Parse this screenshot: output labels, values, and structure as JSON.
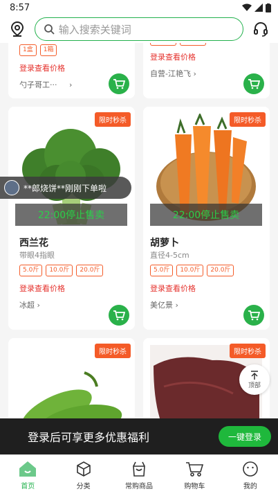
{
  "status": {
    "time": "8:57"
  },
  "search": {
    "placeholder": "输入搜索关键词"
  },
  "feed": {
    "top_left": {
      "tags": [
        "1盒",
        "1箱"
      ],
      "price_login": "登录查看价格",
      "seller": "勺子哥工···"
    },
    "top_right": {
      "price_login": "登录查看价格",
      "seller": "自营-江艳飞"
    },
    "products": [
      {
        "badge": "限时秒杀",
        "overlay": "22:00停止售卖",
        "name": "西兰花",
        "spec": "带眼4指眼",
        "tags": [
          "5.0斤",
          "10.0斤",
          "20.0斤"
        ],
        "price_login": "登录查看价格",
        "seller": "冰超"
      },
      {
        "badge": "限时秒杀",
        "overlay": "22:00停止售卖",
        "name": "胡萝卜",
        "spec": "直径4-5cm",
        "tags": [
          "5.0斤",
          "10.0斤",
          "20.0斤"
        ],
        "price_login": "登录查看价格",
        "seller": "美亿景"
      },
      {
        "badge": "限时秒杀"
      },
      {
        "badge": "限时秒杀"
      }
    ]
  },
  "toast": {
    "text": "**郎烧饼**刚刚下单啦"
  },
  "top_button": {
    "label": "顶部"
  },
  "login_banner": {
    "text": "登录后可享更多优惠福利",
    "button": "一键登录"
  },
  "tabs": [
    {
      "label": "首页",
      "icon": "home-icon"
    },
    {
      "label": "分类",
      "icon": "box-icon"
    },
    {
      "label": "常购商品",
      "icon": "bag-icon"
    },
    {
      "label": "购物车",
      "icon": "cart-icon"
    },
    {
      "label": "我的",
      "icon": "smile-icon"
    }
  ],
  "colors": {
    "accent": "#22b14c",
    "badge": "#f45b28",
    "price": "#e5322d"
  }
}
